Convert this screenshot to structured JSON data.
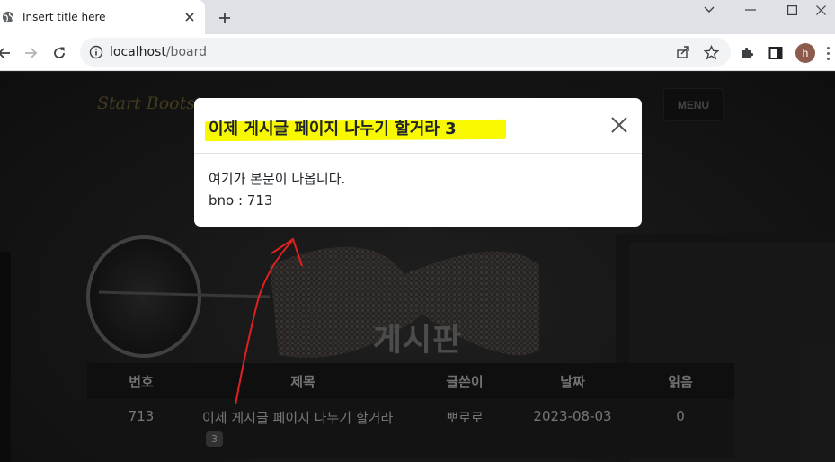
{
  "browser": {
    "tab_title": "Insert title here",
    "url_host": "localhost",
    "url_path": "/board",
    "profile_initial": "h"
  },
  "site": {
    "brand": "Start Bootstrap",
    "menu_label": "MENU",
    "heading": "게시판"
  },
  "board": {
    "columns": [
      "번호",
      "제목",
      "글쓴이",
      "날짜",
      "읽음"
    ],
    "rows": [
      {
        "no": "713",
        "title": "이제 게시글 페이지 나누기 할거라",
        "badge": "3",
        "writer": "뽀로로",
        "date": "2023-08-03",
        "read": "0"
      }
    ]
  },
  "modal": {
    "title": "이제 게시글 페이지 나누기 할거라 3",
    "body_line1": "여기가 본문이 나옵니다.",
    "body_line2": "bno : 713"
  },
  "colors": {
    "highlight": "#f8f800",
    "annotation": "#e02020",
    "brand": "#c9a64a"
  }
}
